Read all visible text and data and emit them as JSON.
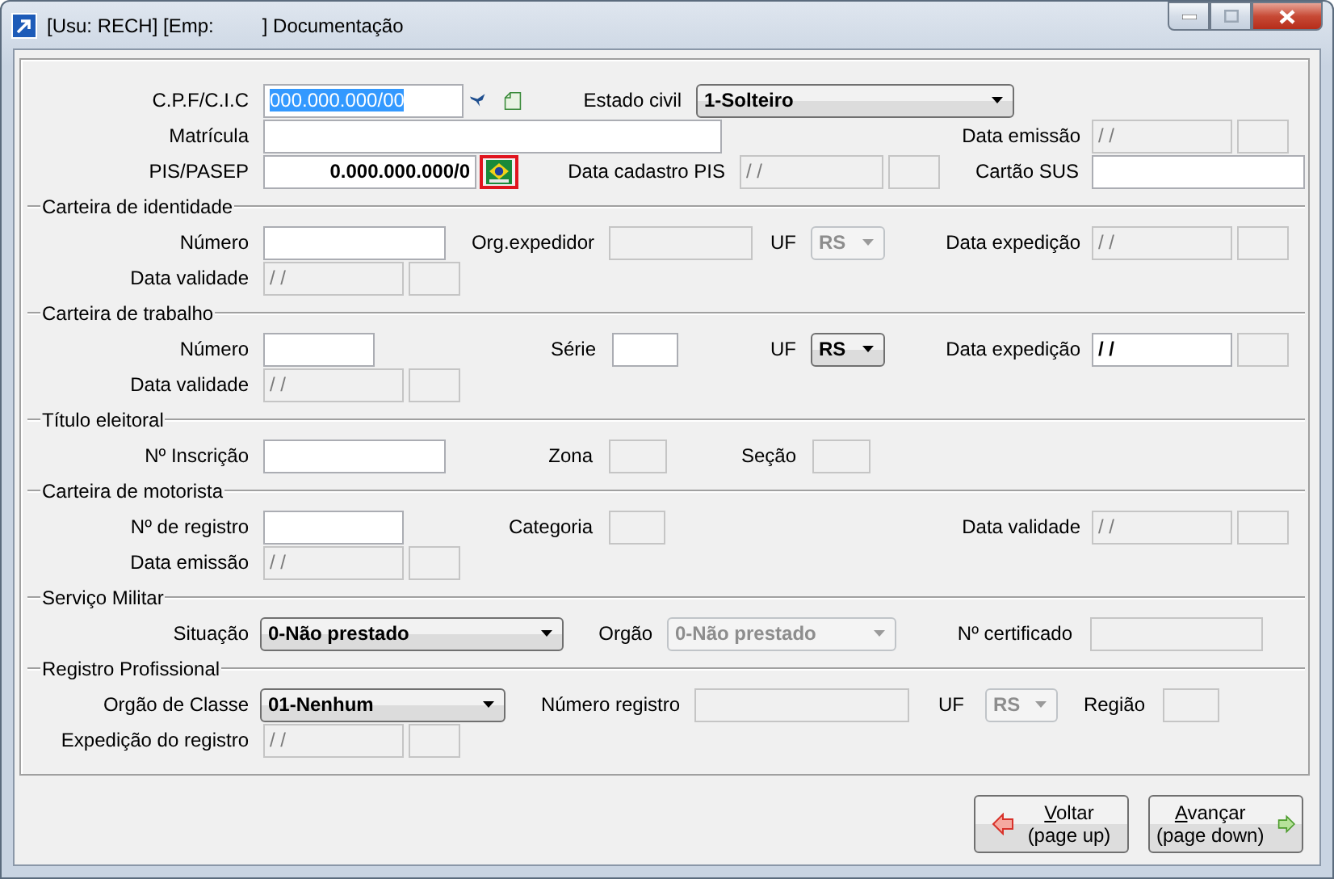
{
  "window": {
    "title": "[Usu: RECH] [Emp:         ] Documentação"
  },
  "sections": [
    {
      "rows": [
        {
          "items": [
            {
              "kind": "label",
              "text": "C.P.F/C.I.C"
            },
            {
              "kind": "field",
              "value": "000.000.000/00",
              "text_selected": true
            },
            {
              "kind": "icon"
            },
            {
              "kind": "icon"
            },
            {
              "kind": "label",
              "text": "Estado civil"
            },
            {
              "kind": "combo",
              "value": "1-Solteiro",
              "disabled": false
            }
          ]
        },
        {
          "items": [
            {
              "kind": "label",
              "text": "Matrícula"
            },
            {
              "kind": "field",
              "value": ""
            },
            {
              "kind": "label",
              "text": "Data emissão"
            },
            {
              "kind": "field",
              "value": "/ /",
              "disabled": true
            },
            {
              "kind": "field",
              "disabled": true
            }
          ]
        },
        {
          "items": [
            {
              "kind": "label",
              "text": "PIS/PASEP"
            },
            {
              "kind": "field",
              "value": "0.000.000.000/0",
              "bold": true
            },
            {
              "kind": "icon",
              "highlighted": true
            },
            {
              "kind": "label",
              "text": "Data cadastro PIS"
            },
            {
              "kind": "field",
              "value": "/ /",
              "disabled": true
            },
            {
              "kind": "field",
              "disabled": true
            },
            {
              "kind": "label",
              "text": "Cartão SUS"
            },
            {
              "kind": "field",
              "value": ""
            }
          ]
        }
      ]
    },
    {
      "title": "Carteira de identidade",
      "rows": [
        {
          "items": [
            {
              "kind": "label",
              "text": "Número"
            },
            {
              "kind": "field",
              "value": ""
            },
            {
              "kind": "label",
              "text": "Org.expedidor"
            },
            {
              "kind": "field",
              "disabled": true
            },
            {
              "kind": "label",
              "text": "UF"
            },
            {
              "kind": "combo",
              "value": "RS",
              "disabled": true
            },
            {
              "kind": "label",
              "text": "Data expedição"
            },
            {
              "kind": "field",
              "value": "/ /",
              "disabled": true
            },
            {
              "kind": "field",
              "disabled": true
            }
          ]
        },
        {
          "items": [
            {
              "kind": "label",
              "text": "Data validade"
            },
            {
              "kind": "field",
              "value": "/ /",
              "disabled": true
            },
            {
              "kind": "field",
              "disabled": true
            }
          ]
        }
      ]
    },
    {
      "title": "Carteira de trabalho",
      "rows": [
        {
          "items": [
            {
              "kind": "label",
              "text": "Número"
            },
            {
              "kind": "field",
              "value": ""
            },
            {
              "kind": "label",
              "text": "Série"
            },
            {
              "kind": "field",
              "value": ""
            },
            {
              "kind": "label",
              "text": "UF"
            },
            {
              "kind": "combo",
              "value": "RS",
              "disabled": false
            },
            {
              "kind": "label",
              "text": "Data expedição"
            },
            {
              "kind": "field",
              "value": "/ /",
              "bold": true
            },
            {
              "kind": "field",
              "disabled": true
            }
          ]
        },
        {
          "items": [
            {
              "kind": "label",
              "text": "Data validade"
            },
            {
              "kind": "field",
              "value": "/ /",
              "disabled": true
            },
            {
              "kind": "field",
              "disabled": true
            }
          ]
        }
      ]
    },
    {
      "title": "Título eleitoral",
      "rows": [
        {
          "items": [
            {
              "kind": "label",
              "text": "Nº Inscrição"
            },
            {
              "kind": "field",
              "value": ""
            },
            {
              "kind": "label",
              "text": "Zona"
            },
            {
              "kind": "field",
              "disabled": true
            },
            {
              "kind": "label",
              "text": "Seção"
            },
            {
              "kind": "field",
              "disabled": true
            }
          ]
        }
      ]
    },
    {
      "title": "Carteira de motorista",
      "rows": [
        {
          "items": [
            {
              "kind": "label",
              "text": "Nº de registro"
            },
            {
              "kind": "field",
              "value": ""
            },
            {
              "kind": "label",
              "text": "Categoria"
            },
            {
              "kind": "field",
              "disabled": true
            },
            {
              "kind": "label",
              "text": "Data validade"
            },
            {
              "kind": "field",
              "value": "/ /",
              "disabled": true
            },
            {
              "kind": "field",
              "disabled": true
            }
          ]
        },
        {
          "items": [
            {
              "kind": "label",
              "text": "Data emissão"
            },
            {
              "kind": "field",
              "value": "/ /",
              "disabled": true
            },
            {
              "kind": "field",
              "disabled": true
            }
          ]
        }
      ]
    },
    {
      "title": "Serviço Militar",
      "rows": [
        {
          "items": [
            {
              "kind": "label",
              "text": "Situação"
            },
            {
              "kind": "combo",
              "value": "0-Não prestado",
              "disabled": false
            },
            {
              "kind": "label",
              "text": "Orgão"
            },
            {
              "kind": "combo",
              "value": "0-Não prestado",
              "disabled": true
            },
            {
              "kind": "label",
              "text": "Nº certificado"
            },
            {
              "kind": "field",
              "disabled": true
            }
          ]
        }
      ]
    },
    {
      "title": "Registro Profissional",
      "rows": [
        {
          "items": [
            {
              "kind": "label",
              "text": "Orgão de Classe"
            },
            {
              "kind": "combo",
              "value": "01-Nenhum",
              "disabled": false
            },
            {
              "kind": "label",
              "text": "Número registro"
            },
            {
              "kind": "field",
              "disabled": true
            },
            {
              "kind": "label",
              "text": "UF"
            },
            {
              "kind": "combo",
              "value": "RS",
              "disabled": true
            },
            {
              "kind": "label",
              "text": "Região"
            },
            {
              "kind": "field",
              "disabled": true
            }
          ]
        },
        {
          "items": [
            {
              "kind": "label",
              "text": "Expedição do registro"
            },
            {
              "kind": "field",
              "value": "/ /",
              "disabled": true
            },
            {
              "kind": "field",
              "disabled": true
            }
          ]
        }
      ]
    }
  ],
  "buttons": [
    {
      "kind": "back",
      "label": "Voltar",
      "hint": "(page up)",
      "underline_first": true
    },
    {
      "kind": "forward",
      "label": "Avançar",
      "hint": "(page down)",
      "underline_first": true
    }
  ]
}
